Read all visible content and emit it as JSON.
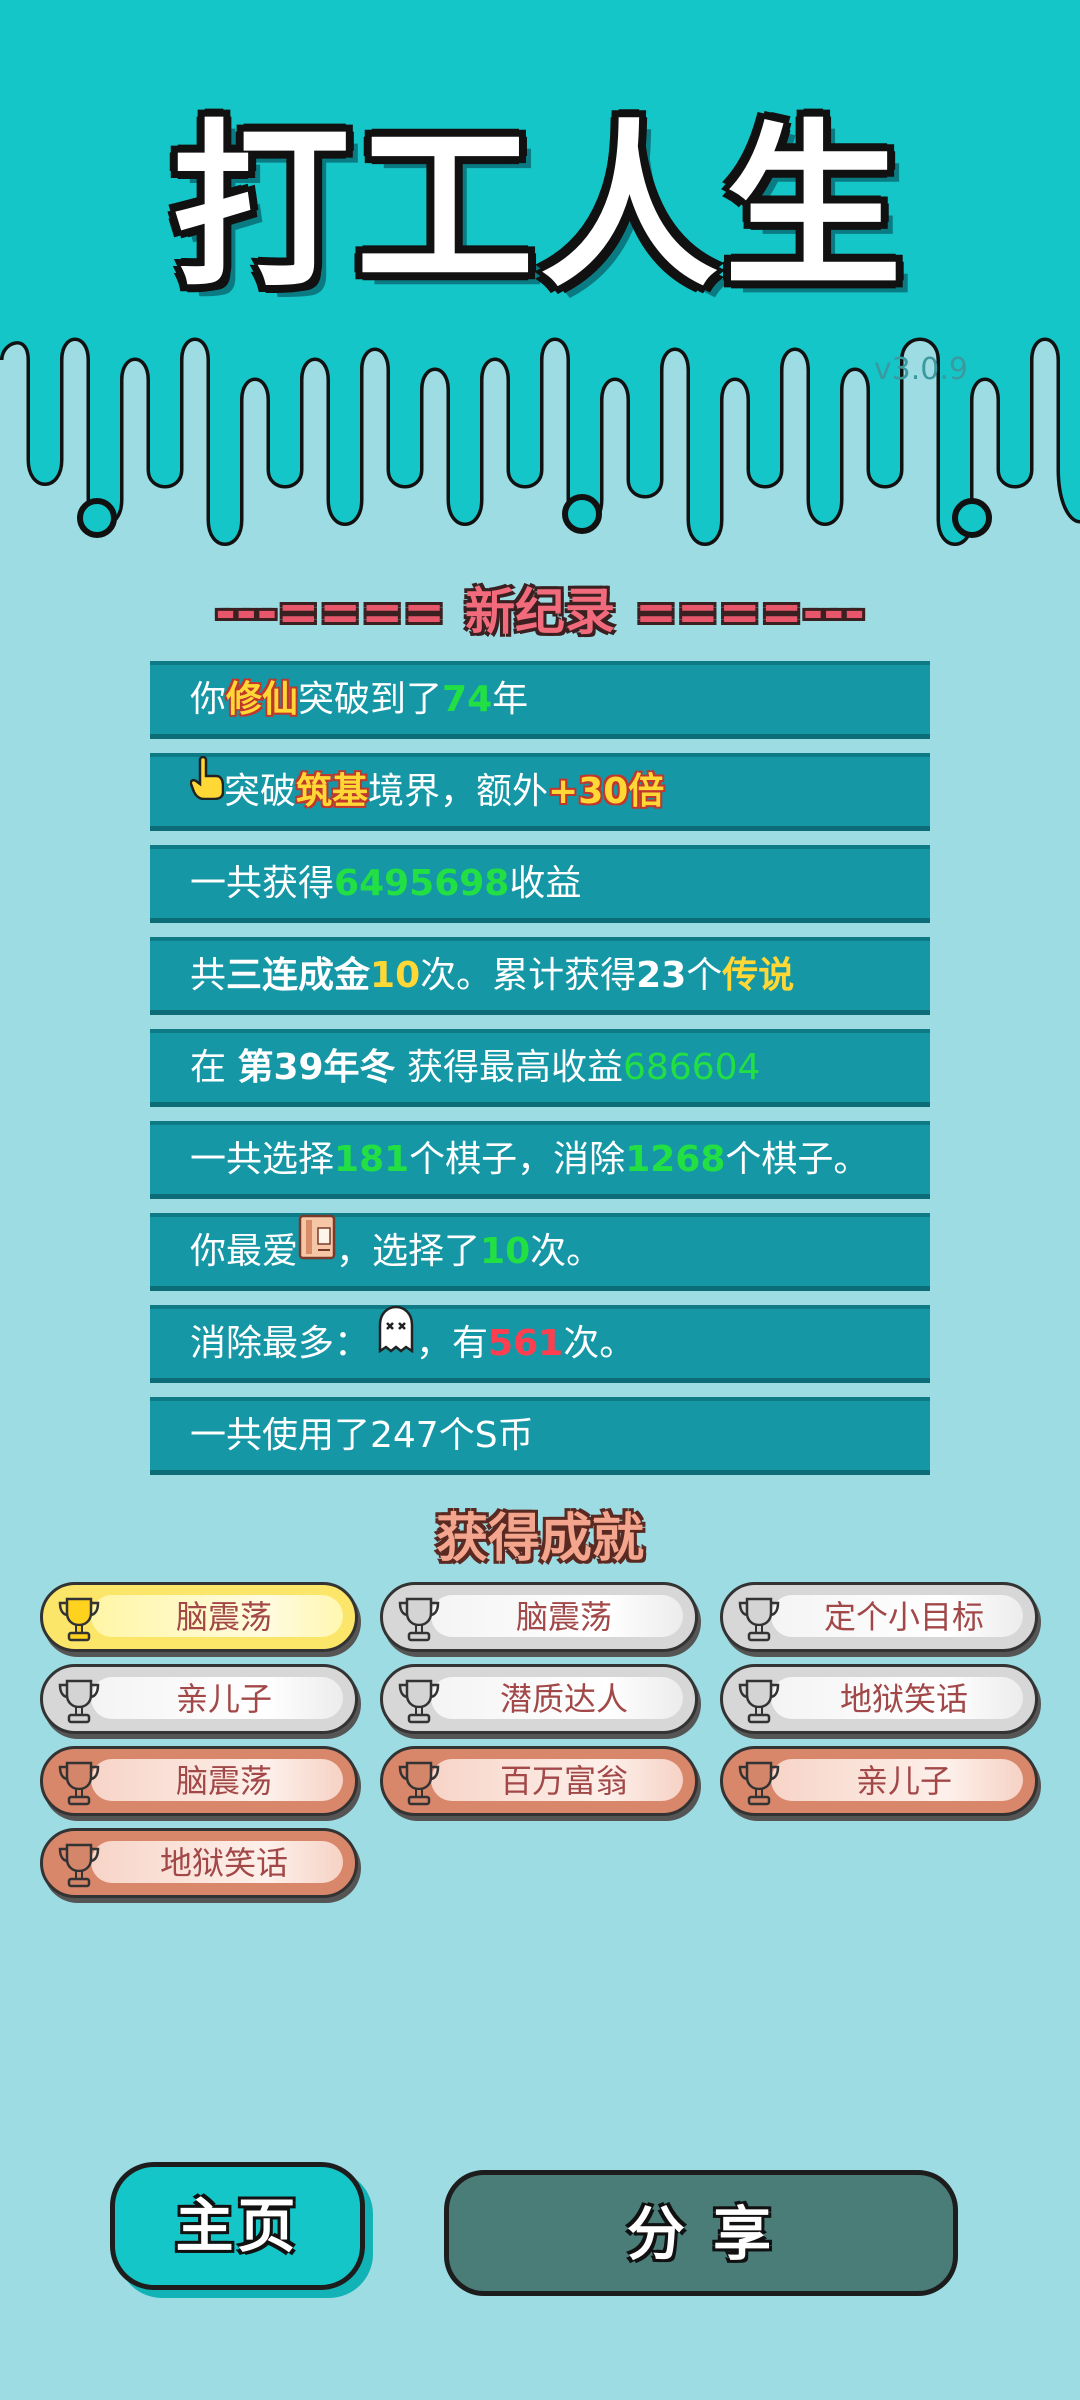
{
  "header": {
    "title": "打工人生",
    "version": "v3.0.9"
  },
  "record": {
    "dashes_left": "---====",
    "title": "新纪录",
    "dashes_right": "====---"
  },
  "stats": {
    "r1": {
      "a": "你",
      "b": "修仙",
      "c": "突破到了",
      "d": "74",
      "e": "年"
    },
    "r2": {
      "icon": "pointing-hand-icon",
      "a": "突破",
      "b": "筑基",
      "c": "境界，额外",
      "d": "+30倍"
    },
    "r3": {
      "a": "一共获得",
      "b": "6495698",
      "c": "收益"
    },
    "r4": {
      "a": "共",
      "b": "三连成金",
      "c": "10",
      "d": "次。累计获得",
      "e": "23",
      "f": "个",
      "g": "传说"
    },
    "r5": {
      "a": "在 ",
      "b": "第39年冬",
      "c": " 获得最高收益",
      "d": "686604"
    },
    "r6": {
      "a": "一共选择",
      "b": "181",
      "c": "个棋子，消除",
      "d": "1268",
      "e": "个棋子。"
    },
    "r7": {
      "a": "你最爱",
      "icon": "book-icon",
      "b": "，选择了",
      "c": "10",
      "d": "次。"
    },
    "r8": {
      "a": "消除最多：",
      "icon": "ghost-icon",
      "b": "，有",
      "c": "561",
      "d": "次。"
    },
    "r9": {
      "a": "一共使用了247个S币"
    }
  },
  "achievements": {
    "title": "获得成就",
    "items": [
      {
        "label": "脑震荡",
        "tier": "gold"
      },
      {
        "label": "脑震荡",
        "tier": "silver"
      },
      {
        "label": "定个小目标",
        "tier": "silver"
      },
      {
        "label": "亲儿子",
        "tier": "silver"
      },
      {
        "label": "潜质达人",
        "tier": "silver"
      },
      {
        "label": "地狱笑话",
        "tier": "silver"
      },
      {
        "label": "脑震荡",
        "tier": "bronze"
      },
      {
        "label": "百万富翁",
        "tier": "bronze"
      },
      {
        "label": "亲儿子",
        "tier": "bronze"
      },
      {
        "label": "地狱笑话",
        "tier": "bronze"
      }
    ]
  },
  "buttons": {
    "home": "主页",
    "share": "分 享"
  },
  "colors": {
    "background": "#9edce3",
    "header": "#15c6c8",
    "row": "#1597a6",
    "highlight_green": "#22e044",
    "highlight_yellow": "#ffd835",
    "highlight_red": "#ff3f4f"
  }
}
